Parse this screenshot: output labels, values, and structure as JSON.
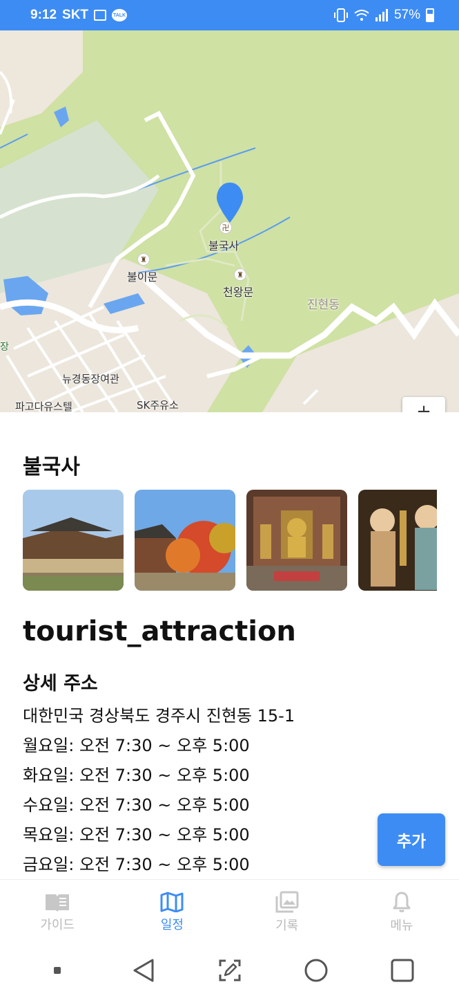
{
  "status_bar": {
    "time": "9:12",
    "carrier": "SKT",
    "talk": "TALK",
    "battery": "57%"
  },
  "map": {
    "labels": {
      "bulguksa": "불국사",
      "bulimun": "불이문",
      "cheonwangmun": "천왕문",
      "jinhyeondong": "진현동",
      "newgyeongdong": "뉴경동장여관",
      "pagoda": "파고다유스텔",
      "sk": "SK주유소",
      "jang": "장"
    },
    "zoom_in": "+",
    "marker_color": "#3d8cf4"
  },
  "place": {
    "name": "불국사",
    "category": "tourist_attraction",
    "address_heading": "상세 주소",
    "info_lines": [
      "대한민국 경상북도 경주시 진현동 15-1",
      "월요일: 오전 7:30 ~ 오후 5:00",
      "화요일: 오전 7:30 ~ 오후 5:00",
      "수요일: 오전 7:30 ~ 오후 5:00",
      "목요일: 오전 7:30 ~ 오후 5:00",
      "금요일: 오전 7:30 ~ 오후 5:00"
    ]
  },
  "add_button": "추가",
  "bottom_nav": {
    "guide": "가이드",
    "schedule": "일정",
    "record": "기록",
    "menu": "메뉴"
  },
  "colors": {
    "accent": "#3d8cf4",
    "inactive": "#b9b9b9"
  }
}
